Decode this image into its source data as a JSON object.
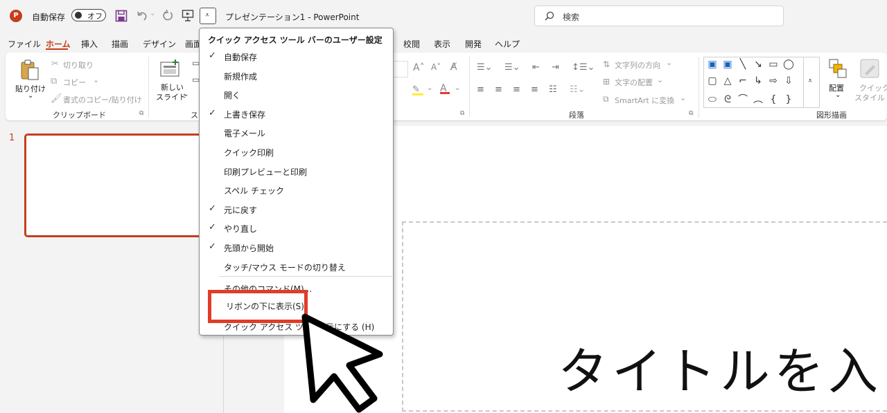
{
  "titlebar": {
    "autosave_label": "自動保存",
    "toggle_label": "オフ",
    "document_title": "プレゼンテーション1 - PowerPoint",
    "search_placeholder": "検索"
  },
  "menu_tabs": [
    "ファイル",
    "ホーム",
    "挿入",
    "描画",
    "デザイン",
    "画面",
    "校閲",
    "表示",
    "開発",
    "ヘルプ"
  ],
  "ribbon": {
    "paste": "貼り付け",
    "cut": "切り取り",
    "copy": "コピー",
    "format_painter": "書式のコピー/貼り付け",
    "clipboard_group": "クリップボード",
    "new_slide_line1": "新しい",
    "new_slide_line2": "スライド",
    "slides_group_fragment": "ス",
    "text_direction": "文字列の方向",
    "align_text": "文字の配置",
    "smartart": "SmartArt に変換",
    "paragraph_group": "段落",
    "arrange": "配置",
    "quick_style_line1": "クイック",
    "quick_style_line2": "スタイル",
    "drawing_group": "図形描画"
  },
  "quick_access_menu": {
    "heading": "クイック アクセス ツール バーのユーザー設定",
    "items": [
      {
        "label": "自動保存",
        "checked": true
      },
      {
        "label": "新規作成",
        "checked": false
      },
      {
        "label": "開く",
        "checked": false
      },
      {
        "label": "上書き保存",
        "checked": true
      },
      {
        "label": "電子メール",
        "checked": false
      },
      {
        "label": "クイック印刷",
        "checked": false
      },
      {
        "label": "印刷プレビューと印刷",
        "checked": false
      },
      {
        "label": "スペル チェック",
        "checked": false
      },
      {
        "label": "元に戻す",
        "checked": true
      },
      {
        "label": "やり直し",
        "checked": true
      },
      {
        "label": "先頭から開始",
        "checked": true
      },
      {
        "label": "タッチ/マウス モードの切り替え",
        "checked": false
      }
    ],
    "more_commands": "その他のコマンド(M)...",
    "show_below_ribbon": "リボンの下に表示(S)",
    "hide_visible_start": "クイック アクセス ツール",
    "hide_visible_end": "表示にする (H)"
  },
  "slides": {
    "thumbnail_number": "1",
    "title_placeholder": "タイトルを入"
  },
  "colors": {
    "accent": "#c43e1c",
    "highlight": "#e03c28"
  }
}
